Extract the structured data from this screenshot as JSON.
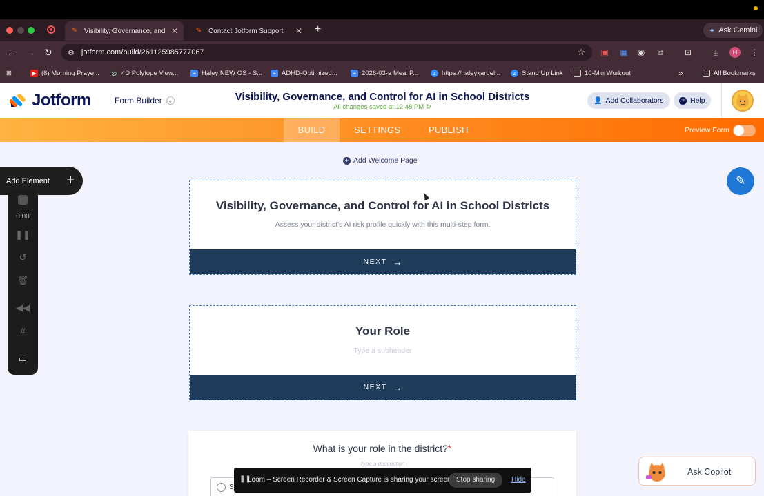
{
  "browser": {
    "tabs": [
      {
        "label": "Visibility, Governance, and Co",
        "active": true
      },
      {
        "label": "Contact Jotform Support",
        "active": false
      }
    ],
    "ask_gemini": "Ask Gemini",
    "url": "jotform.com/build/261125985777067",
    "profile_initial": "H",
    "bookmarks": [
      "(8) Morning Praye...",
      "4D Polytope View...",
      "Haley NEW OS - S...",
      "ADHD-Optimized...",
      "2026-03-a Meal P...",
      "https://haleykardel...",
      "Stand Up Link",
      "10-Min Workout"
    ],
    "bookmarks_more": "»",
    "all_bookmarks": "All Bookmarks"
  },
  "header": {
    "logo_text": "Jotform",
    "form_builder": "Form Builder",
    "title": "Visibility, Governance, and Control for AI in School Districts",
    "saved_status": "All changes saved at 12:48 PM",
    "add_collaborators": "Add Collaborators",
    "help": "Help"
  },
  "nav": {
    "tabs": [
      "BUILD",
      "SETTINGS",
      "PUBLISH"
    ],
    "active": "BUILD",
    "preview_form": "Preview Form"
  },
  "canvas": {
    "add_welcome": "Add Welcome Page",
    "card1": {
      "title": "Visibility, Governance, and Control for AI in School Districts",
      "subtitle": "Assess your district's AI risk profile quickly with this multi-step form.",
      "next": "NEXT"
    },
    "card2": {
      "title": "Your Role",
      "subtitle_placeholder": "Type a subheader",
      "next": "NEXT"
    },
    "question": {
      "label": "What is your role in the district?",
      "required_mark": "*",
      "desc_placeholder": "Type a description",
      "first_option_partial": "Se"
    }
  },
  "left_panel": {
    "add_element": "Add Element",
    "timer": "0:00"
  },
  "copilot": "Ask Copilot",
  "share_bar": {
    "message": "Loom – Screen Recorder & Screen Capture is sharing your screen.",
    "stop": "Stop sharing",
    "hide": "Hide"
  },
  "colors": {
    "brand_navy": "#0a1551",
    "next_button": "#1e3c5a",
    "orange_start": "#ffb340",
    "orange_end": "#ff6b00",
    "saved_green": "#5aa83a",
    "fab_blue": "#1f77d6"
  }
}
